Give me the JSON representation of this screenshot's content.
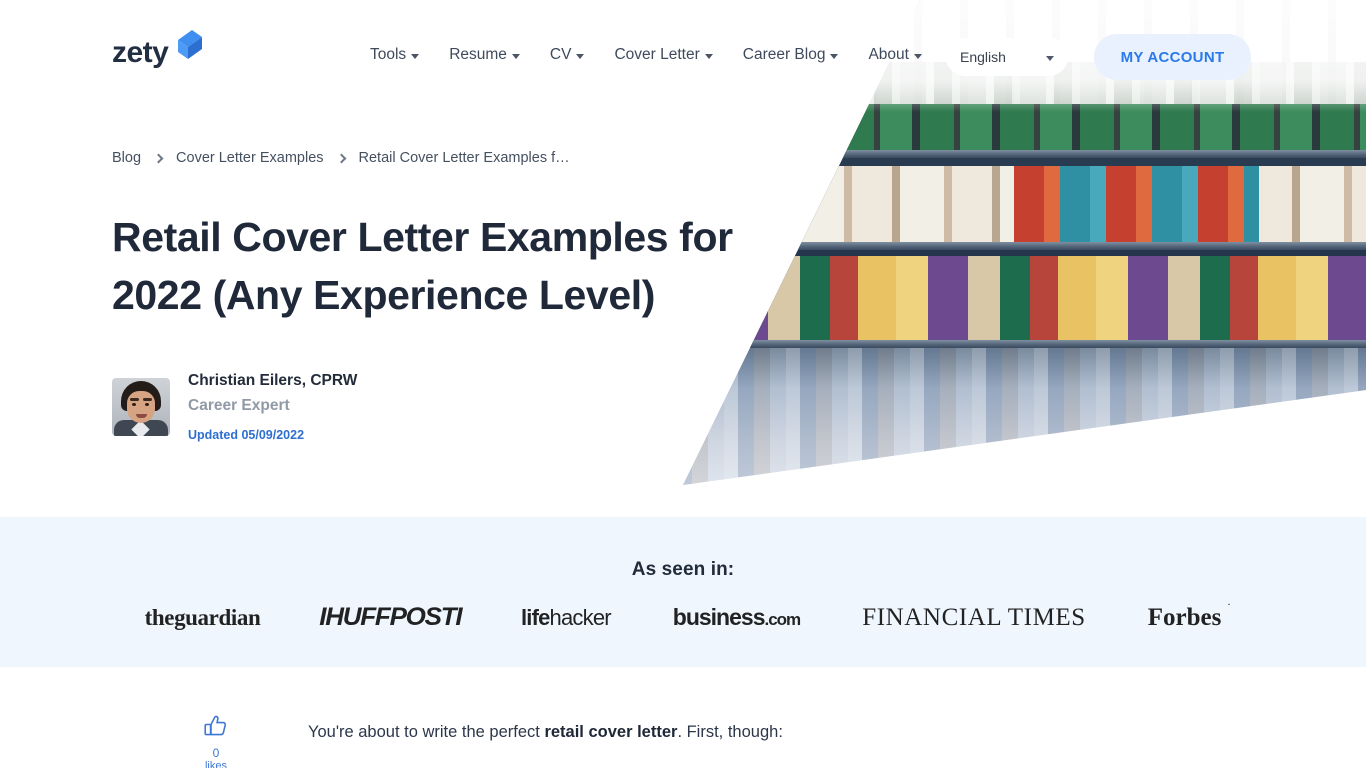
{
  "header": {
    "logo_text": "zety",
    "logo_icon": "zety-arrow-logo",
    "nav": [
      {
        "label": "Tools",
        "icon": "chevron-down-icon"
      },
      {
        "label": "Resume",
        "icon": "chevron-down-icon"
      },
      {
        "label": "CV",
        "icon": "chevron-down-icon"
      },
      {
        "label": "Cover Letter",
        "icon": "chevron-down-icon"
      },
      {
        "label": "Career Blog",
        "icon": "chevron-down-icon"
      },
      {
        "label": "About",
        "icon": "chevron-down-icon"
      }
    ],
    "language": {
      "value": "English",
      "icon": "chevron-down-icon"
    },
    "account_label": "MY ACCOUNT",
    "account_color": "#2a7aea"
  },
  "article": {
    "breadcrumb": [
      {
        "label": "Blog"
      },
      {
        "label": "Cover Letter Examples"
      },
      {
        "label": "Retail Cover Letter Examples f…"
      }
    ],
    "breadcrumb_separator_icon": "chevron-right-icon",
    "title": "Retail Cover Letter Examples for 2022 (Any Experience Level)",
    "author": {
      "avatar_icon": "author-avatar",
      "name": "Christian Eilers, CPRW",
      "role": "Career Expert",
      "updated": "Updated 05/09/2022",
      "updated_color": "#2f6fd0"
    },
    "hero_image_alt": "retail-store-shelves-photo"
  },
  "as_seen_in": {
    "title": "As seen in:",
    "background": "#eff6fd",
    "logos": [
      {
        "name": "theguardian",
        "text": "theguardian"
      },
      {
        "name": "huffpost",
        "text": "IHUFFPOSTI"
      },
      {
        "name": "lifehacker",
        "bold": "life",
        "light": "hacker"
      },
      {
        "name": "business-com",
        "bold": "business",
        "light": ".com"
      },
      {
        "name": "financial-times",
        "text": "FINANCIAL TIMES"
      },
      {
        "name": "forbes",
        "text": "Forbes",
        "mark": "."
      }
    ]
  },
  "content": {
    "like": {
      "icon": "thumbs-up-icon",
      "count": "0",
      "label": "likes",
      "color": "#3f77d6"
    },
    "lead_before": "You're about to write the perfect ",
    "lead_bold": "retail cover letter",
    "lead_after": ". First, though:"
  }
}
